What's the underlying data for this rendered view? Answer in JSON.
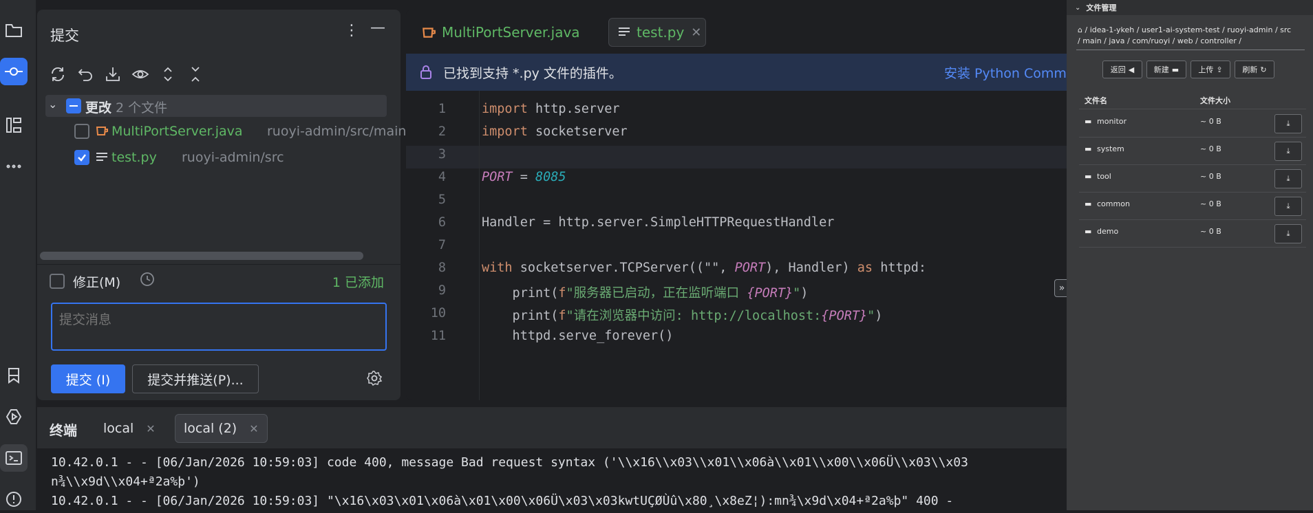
{
  "commit_panel": {
    "title": "提交",
    "changes_label": "更改",
    "changes_count": "2 个文件",
    "files": [
      {
        "name": "MultiPortServer.java",
        "path": "ruoyi-admin/src/main"
      },
      {
        "name": "test.py",
        "path": "ruoyi-admin/src"
      }
    ],
    "amend_label": "修正(M)",
    "added_status": "1 已添加",
    "message_placeholder": "提交消息",
    "commit_button": "提交 (I)",
    "commit_push_button": "提交并推送(P)..."
  },
  "editor": {
    "tabs": [
      {
        "label": "MultiPortServer.java"
      },
      {
        "label": "test.py"
      }
    ],
    "notice_text": "已找到支持 *.py 文件的插件。",
    "notice_action": "安装 Python Comm",
    "line_numbers": [
      "1",
      "2",
      "3",
      "4",
      "5",
      "6",
      "7",
      "8",
      "9",
      "10",
      "11"
    ],
    "code": {
      "l1_kw": "import",
      "l1_rest": " http.server",
      "l2_kw": "import",
      "l2_rest": " socketserver",
      "l4_const": "PORT",
      "l4_eq": " = ",
      "l4_num": "8085",
      "l6": "Handler = http.server.SimpleHTTPRequestHandler",
      "l8_kw": "with",
      "l8_a": " socketserver.TCPServer((\"\", ",
      "l8_const": "PORT",
      "l8_b": "), Handler) ",
      "l8_kw2": "as",
      "l8_c": " httpd:",
      "l9_a": "    print(",
      "l9_f": "f",
      "l9_str": "\"服务器已启动，正在监听端口 ",
      "l9_const": "{PORT}",
      "l9_end": "\"",
      "l9_close": ")",
      "l10_a": "    print(",
      "l10_f": "f",
      "l10_str": "\"请在浏览器中访问: http://localhost:",
      "l10_const": "{PORT}",
      "l10_end": "\"",
      "l10_close": ")",
      "l11": "    httpd.serve_forever()"
    }
  },
  "terminal": {
    "title": "终端",
    "tabs": [
      {
        "label": "local"
      },
      {
        "label": "local (2)"
      }
    ],
    "lines": [
      "10.42.0.1 - - [06/Jan/2026 10:59:03] code 400, message Bad request syntax ('\\\\x16\\\\x03\\\\x01\\\\x06à\\\\x01\\\\x00\\\\x06Ü\\\\x03\\\\x03",
      "n¾\\\\x9d\\\\x04+ª2a%þ')",
      "10.42.0.1 - - [06/Jan/2026 10:59:03] \"\\x16\\x03\\x01\\x06à\\x01\\x00\\x06Ü\\x03\\x03kwtUÇØÙû\\x80¸\\x8eZ¦):mn¾\\x9d\\x04+ª2a%þ\" 400 -"
    ]
  },
  "file_manager": {
    "title": "文件管理",
    "breadcrumb_line1": [
      "idea-1-ykeh",
      "user1-ai-system-test",
      "ruoyi-admin",
      "src"
    ],
    "breadcrumb_line2": [
      "main",
      "java",
      "com/ruoyi",
      "web",
      "controller"
    ],
    "buttons": {
      "back": "返回",
      "new": "新建",
      "upload": "上传",
      "refresh": "刷新"
    },
    "columns": {
      "name": "文件名",
      "size": "文件大小"
    },
    "rows": [
      {
        "name": "monitor",
        "size": "~ 0 B"
      },
      {
        "name": "system",
        "size": "~ 0 B"
      },
      {
        "name": "tool",
        "size": "~ 0 B"
      },
      {
        "name": "common",
        "size": "~ 0 B"
      },
      {
        "name": "demo",
        "size": "~ 0 B"
      }
    ]
  }
}
